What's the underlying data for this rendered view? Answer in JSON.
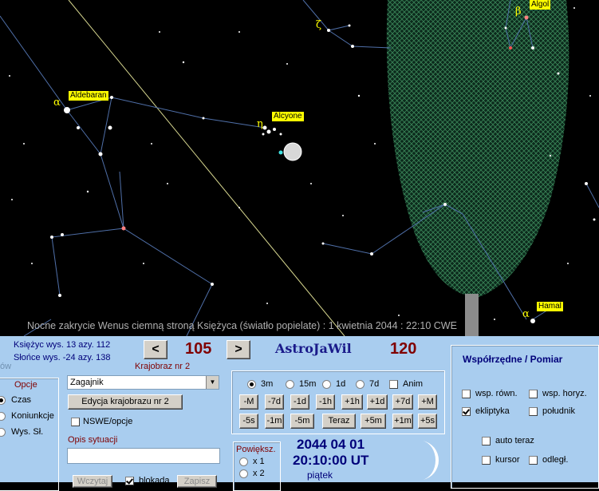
{
  "sky": {
    "labels": {
      "aldebaran": "Aldebaran",
      "alcyone": "Alcyone",
      "algol": "Algol",
      "hamal": "Hamal"
    },
    "greek": {
      "alpha_tau": "α",
      "eta_tau": "η",
      "zeta": "ζ",
      "beta_per": "β",
      "alpha_ari": "α"
    },
    "caption": "Nocne zakrycie Wenus ciemną stroną Księżyca (światło popielate) : 1 kwietnia 2044 :  22:10 CWE"
  },
  "panel": {
    "moon_info": "Księżyc wys. 13  azy. 112",
    "sun_info": "Słońce wys. -24  azy. 138",
    "cut_text": "ów",
    "prev_label": "<",
    "next_label": ">",
    "landscape_number": "105",
    "landscape_label": "Krajobraz nr 2",
    "app_title": "AstroJaWil",
    "app_number": "120",
    "options_title": "Opcje",
    "options": [
      "Czas",
      "Koniunkcje",
      "Wys. Sł."
    ],
    "options_selected": "Czas",
    "landscape_select": "Zagajnik",
    "edit_landscape": "Edycja krajobrazu nr 2",
    "nswe_label": "NSWE/opcje",
    "situation_label": "Opis sytuacji",
    "situation_value": "",
    "load_label": "Wczytaj",
    "lock_label": "blokada",
    "save_label": "Zapisz",
    "step_options": [
      "3m",
      "15m",
      "1d",
      "7d"
    ],
    "step_selected": "3m",
    "anim_label": "Anim",
    "row1": [
      "-M",
      "-7d",
      "-1d",
      "-1h",
      "+1h",
      "+1d",
      "+7d",
      "+M"
    ],
    "row2": [
      "-5s",
      "-1m",
      "-5m",
      "Teraz",
      "+5m",
      "+1m",
      "+5s"
    ],
    "zoom_title": "Powiększ.",
    "zoom_options": [
      "x 1",
      "x 2"
    ],
    "date": "2044 04 01",
    "time": "20:10:00 UT",
    "weekday": "piątek",
    "coords_title": "Współrzędne / Pomiar",
    "coords": {
      "eq": "wsp. równ.",
      "hor": "wsp. horyz.",
      "ecl": "ekliptyka",
      "merid": "południk",
      "auto": "auto teraz",
      "cursor": "kursor",
      "dist": "odległ."
    }
  },
  "colors": {
    "sky": "#000000",
    "panel": "#a9cdef",
    "label_bg": "#ffff00",
    "ecliptic": "#ffff99",
    "constellation": "#4f6fa8",
    "hatch": "#2f6f4f"
  }
}
